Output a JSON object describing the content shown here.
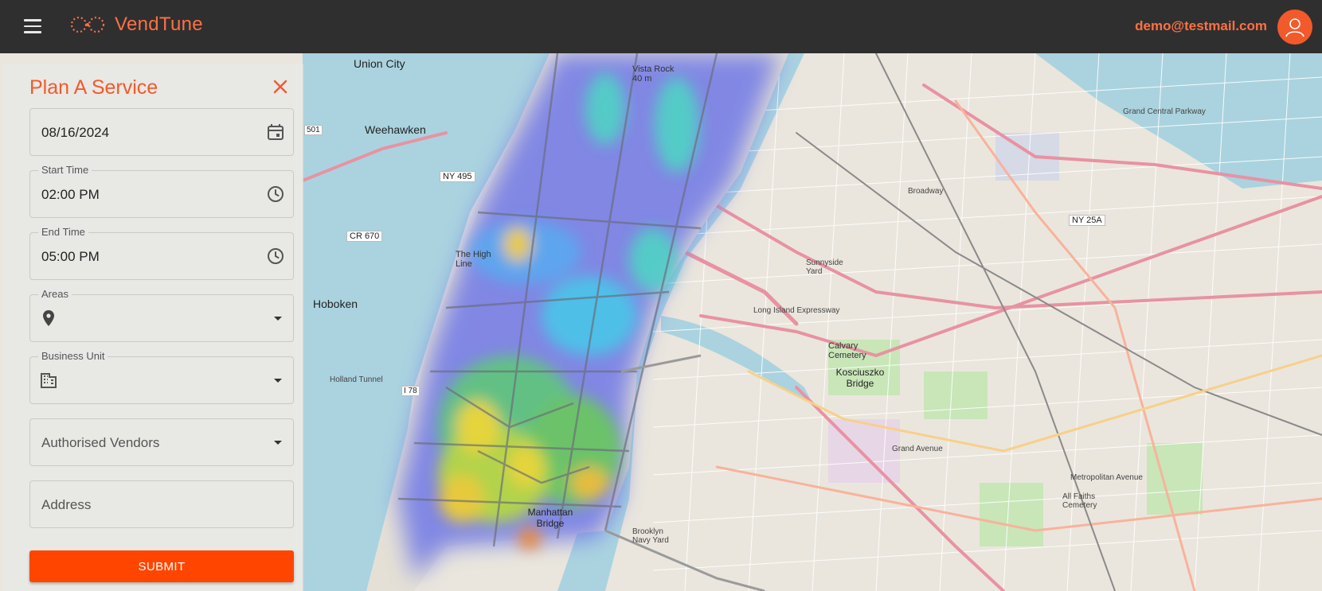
{
  "app": {
    "brand": "VendTune",
    "user_email": "demo@testmail.com",
    "accent": "#f25a2b"
  },
  "icons": {
    "menu": "hamburger-menu-icon",
    "logo": "vendtune-logo-icon",
    "avatar": "user-avatar-icon",
    "close": "close-icon",
    "calendar": "calendar-icon",
    "clock": "clock-icon",
    "location": "location-pin-icon",
    "building": "building-icon",
    "dropdown": "chevron-down-icon"
  },
  "panel": {
    "title": "Plan A Service",
    "date": {
      "value": "08/16/2024"
    },
    "start_time": {
      "label": "Start Time",
      "value": "02:00 PM"
    },
    "end_time": {
      "label": "End Time",
      "value": "05:00 PM"
    },
    "areas": {
      "label": "Areas",
      "value": ""
    },
    "business_unit": {
      "label": "Business Unit",
      "value": ""
    },
    "authorised_vendors": {
      "placeholder": "Authorised Vendors"
    },
    "address": {
      "placeholder": "Address"
    },
    "submit_label": "SUBMIT"
  },
  "map": {
    "labels": [
      "Union City",
      "Weehawken",
      "Hoboken",
      "NY 495",
      "CR 670",
      "501",
      "The High Line",
      "Vista Rock 40 m",
      "Manhattan Bridge",
      "Kosciuszko Bridge",
      "Calvary Cemetery",
      "NY 25A",
      "Grand Central Parkway",
      "Metropolitan Avenue",
      "Brooklyn Navy Yard",
      "Long Island Expressway",
      "Holland Tunnel",
      "I 78",
      "Sunnyside Yard",
      "All Faiths Cemetery",
      "Broadway",
      "Grand Avenue"
    ]
  }
}
